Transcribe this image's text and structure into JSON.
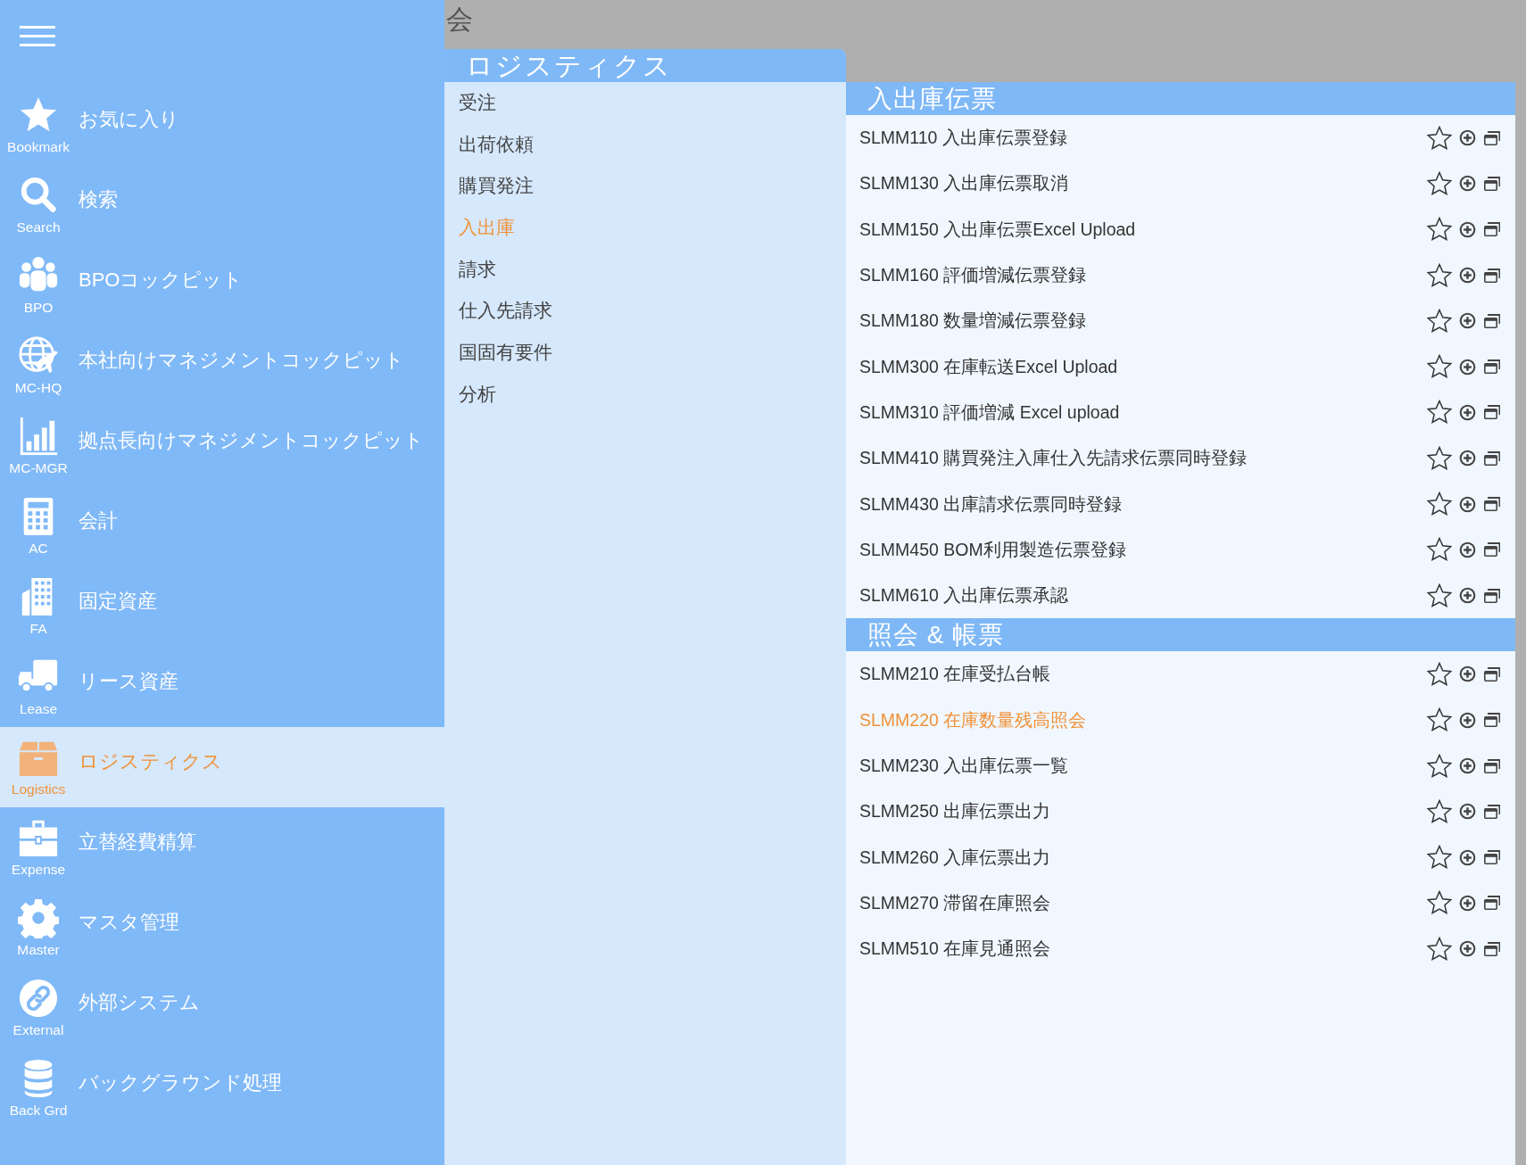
{
  "top_bar": {
    "title": "会"
  },
  "sidebar": {
    "items": [
      {
        "kind": "star",
        "code": "Bookmark",
        "label": "お気に入り",
        "selected": false
      },
      {
        "kind": "search",
        "code": "Search",
        "label": "検索",
        "selected": false
      },
      {
        "kind": "people",
        "code": "BPO",
        "label": "BPOコックピット",
        "selected": false
      },
      {
        "kind": "globe",
        "code": "MC-HQ",
        "label": "本社向けマネジメントコックピット",
        "selected": false
      },
      {
        "kind": "chart",
        "code": "MC-MGR",
        "label": "拠点長向けマネジメントコックピット",
        "selected": false
      },
      {
        "kind": "calculator",
        "code": "AC",
        "label": "会計",
        "selected": false
      },
      {
        "kind": "building",
        "code": "FA",
        "label": "固定資産",
        "selected": false
      },
      {
        "kind": "truck",
        "code": "Lease",
        "label": "リース資産",
        "selected": false
      },
      {
        "kind": "box",
        "code": "Logistics",
        "label": "ロジスティクス",
        "selected": true
      },
      {
        "kind": "briefcase",
        "code": "Expense",
        "label": "立替経費精算",
        "selected": false
      },
      {
        "kind": "gear",
        "code": "Master",
        "label": "マスタ管理",
        "selected": false
      },
      {
        "kind": "link",
        "code": "External",
        "label": "外部システム",
        "selected": false
      },
      {
        "kind": "database",
        "code": "Back Grd",
        "label": "バックグラウンド処理",
        "selected": false
      }
    ]
  },
  "submenu": {
    "title": "ロジスティクス",
    "items": [
      {
        "label": "受注",
        "selected": false
      },
      {
        "label": "出荷依頼",
        "selected": false
      },
      {
        "label": "購買発注",
        "selected": false
      },
      {
        "label": "入出庫",
        "selected": true
      },
      {
        "label": "請求",
        "selected": false
      },
      {
        "label": "仕入先請求",
        "selected": false
      },
      {
        "label": "国固有要件",
        "selected": false
      },
      {
        "label": "分析",
        "selected": false
      }
    ]
  },
  "sections": [
    {
      "title": "入出庫伝票",
      "rows": [
        {
          "label": "SLMM110 入出庫伝票登録",
          "selected": false,
          "bookmarked": false
        },
        {
          "label": "SLMM130 入出庫伝票取消",
          "selected": false,
          "bookmarked": false
        },
        {
          "label": "SLMM150 入出庫伝票Excel Upload",
          "selected": false,
          "bookmarked": false
        },
        {
          "label": "SLMM160 評価増減伝票登録",
          "selected": false,
          "bookmarked": false
        },
        {
          "label": "SLMM180 数量増減伝票登録",
          "selected": false,
          "bookmarked": false
        },
        {
          "label": "SLMM300 在庫転送Excel Upload",
          "selected": false,
          "bookmarked": false
        },
        {
          "label": "SLMM310 評価増減 Excel upload",
          "selected": false,
          "bookmarked": false
        },
        {
          "label": "SLMM410 購買発注入庫仕入先請求伝票同時登録",
          "selected": false,
          "bookmarked": false
        },
        {
          "label": "SLMM430 出庫請求伝票同時登録",
          "selected": false,
          "bookmarked": false
        },
        {
          "label": "SLMM450 BOM利用製造伝票登録",
          "selected": false,
          "bookmarked": false
        },
        {
          "label": "SLMM610 入出庫伝票承認",
          "selected": false,
          "bookmarked": false
        }
      ]
    },
    {
      "title": "照会 & 帳票",
      "rows": [
        {
          "label": "SLMM210 在庫受払台帳",
          "selected": false,
          "bookmarked": false
        },
        {
          "label": "SLMM220 在庫数量残高照会",
          "selected": true,
          "bookmarked": false
        },
        {
          "label": "SLMM230 入出庫伝票一覧",
          "selected": false,
          "bookmarked": false
        },
        {
          "label": "SLMM250 出庫伝票出力",
          "selected": false,
          "bookmarked": false
        },
        {
          "label": "SLMM260 入庫伝票出力",
          "selected": false,
          "bookmarked": false
        },
        {
          "label": "SLMM270 滞留在庫照会",
          "selected": false,
          "bookmarked": false
        },
        {
          "label": "SLMM510 在庫見通照会",
          "selected": false,
          "bookmarked": false
        }
      ]
    }
  ]
}
